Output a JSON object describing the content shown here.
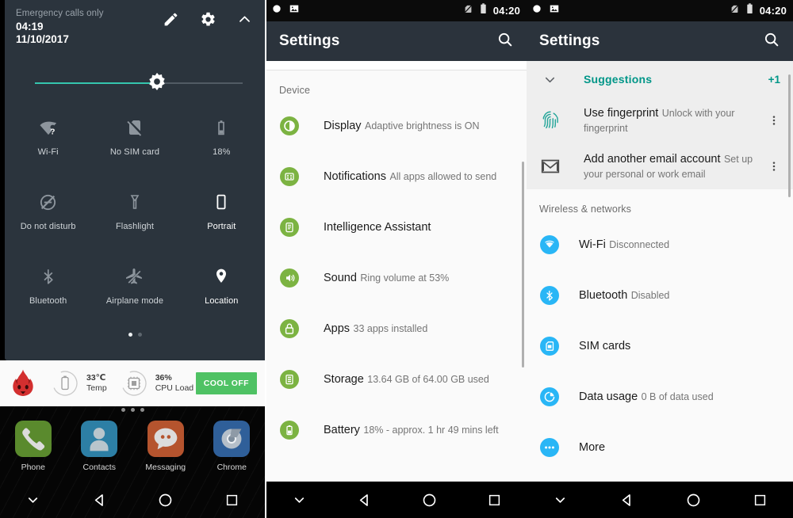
{
  "panel_quick_settings": {
    "status": {
      "carrier": "Emergency calls only",
      "time": "04:19",
      "date": "11/10/2017"
    },
    "header_icons": [
      {
        "name": "edit-pencil-icon",
        "label": "Edit"
      },
      {
        "name": "gear-icon",
        "label": "Settings"
      },
      {
        "name": "chevron-up-icon",
        "label": "Collapse"
      }
    ],
    "brightness": {
      "name": "brightness-slider",
      "value_percent": 55
    },
    "tiles": [
      {
        "label": "Wi-Fi",
        "icon": "wifi-question-icon",
        "state": "off"
      },
      {
        "label": "No SIM card",
        "icon": "no-sim-card-icon",
        "state": "off"
      },
      {
        "label": "18%",
        "icon": "battery-icon",
        "state": "off"
      },
      {
        "label": "Do not disturb",
        "icon": "do-not-disturb-icon",
        "state": "off"
      },
      {
        "label": "Flashlight",
        "icon": "flashlight-icon",
        "state": "off"
      },
      {
        "label": "Portrait",
        "icon": "screen-rotation-portrait-icon",
        "state": "on"
      },
      {
        "label": "Bluetooth",
        "icon": "bluetooth-icon",
        "state": "off"
      },
      {
        "label": "Airplane mode",
        "icon": "airplane-mode-icon",
        "state": "off"
      },
      {
        "label": "Location",
        "icon": "location-pin-icon",
        "state": "on"
      }
    ],
    "page_dots": {
      "count": 2,
      "active_index": 0
    },
    "notification_widget": {
      "app_icon": "antutu-flame-icon",
      "stats": [
        {
          "value": "33℃",
          "label": "Temp",
          "icon": "battery-outline-icon"
        },
        {
          "value": "36%",
          "label": "CPU Load",
          "icon": "cpu-chip-icon"
        }
      ],
      "action_label": "COOL OFF",
      "action_color": "#4fc264"
    },
    "home_screen": {
      "page_dots": {
        "count": 3,
        "active_index": 1
      },
      "dock": [
        {
          "label": "Phone",
          "icon": "phone-handset-icon",
          "color": "#5a8a2d"
        },
        {
          "label": "Contacts",
          "icon": "contacts-person-icon",
          "color": "#2d7fa5"
        },
        {
          "label": "Messaging",
          "icon": "messaging-bubble-icon",
          "color": "#b5542e"
        },
        {
          "label": "Chrome",
          "icon": "chrome-browser-icon",
          "color": "#2f5f99"
        }
      ]
    },
    "navbar": [
      {
        "name": "nav-hide-icon",
        "label": "Hide keyboard"
      },
      {
        "name": "nav-back-icon",
        "label": "Back"
      },
      {
        "name": "nav-home-icon",
        "label": "Home"
      },
      {
        "name": "nav-recents-icon",
        "label": "Recents"
      }
    ]
  },
  "panel_settings": {
    "statusbar": {
      "icons_left": [
        "record-circle-icon",
        "screenshot-image-icon"
      ],
      "icons_right": [
        "no-sim-icon",
        "battery-icon"
      ],
      "clock": "04:20"
    },
    "appbar": {
      "title": "Settings",
      "search_icon": "search-icon"
    },
    "section_label": "Device",
    "items": [
      {
        "title": "Display",
        "subtitle": "Adaptive brightness is ON",
        "icon": "display-brightness-icon",
        "color": "#7cb342"
      },
      {
        "title": "Notifications",
        "subtitle": "All apps allowed to send",
        "icon": "notifications-icon",
        "color": "#7cb342"
      },
      {
        "title": "Intelligence Assistant",
        "subtitle": "",
        "icon": "intelligence-assistant-icon",
        "color": "#7cb342"
      },
      {
        "title": "Sound",
        "subtitle": "Ring volume at 53%",
        "icon": "sound-volume-icon",
        "color": "#7cb342"
      },
      {
        "title": "Apps",
        "subtitle": "33 apps installed",
        "icon": "apps-icon",
        "color": "#7cb342"
      },
      {
        "title": "Storage",
        "subtitle": "13.64 GB of 64.00 GB used",
        "icon": "storage-icon",
        "color": "#7cb342"
      },
      {
        "title": "Battery",
        "subtitle": "18% - approx. 1 hr 49 mins left",
        "icon": "battery-settings-icon",
        "color": "#7cb342"
      }
    ],
    "navbar": [
      {
        "name": "nav-hide-icon",
        "label": "Hide keyboard"
      },
      {
        "name": "nav-back-icon",
        "label": "Back"
      },
      {
        "name": "nav-home-icon",
        "label": "Home"
      },
      {
        "name": "nav-recents-icon",
        "label": "Recents"
      }
    ]
  },
  "panel_suggestions": {
    "statusbar": {
      "icons_left": [
        "record-circle-icon",
        "screenshot-image-icon"
      ],
      "icons_right": [
        "no-sim-icon",
        "battery-icon"
      ],
      "clock": "04:20"
    },
    "appbar": {
      "title": "Settings",
      "search_icon": "search-icon"
    },
    "suggestions": {
      "title": "Suggestions",
      "count_badge": "+1",
      "accent_color": "#009688",
      "items": [
        {
          "title": "Use fingerprint",
          "subtitle": "Unlock with your fingerprint",
          "icon": "fingerprint-icon"
        },
        {
          "title": "Add another email account",
          "subtitle": "Set up your personal or work email",
          "icon": "gmail-envelope-icon"
        }
      ]
    },
    "section_label": "Wireless & networks",
    "items": [
      {
        "title": "Wi-Fi",
        "subtitle": "Disconnected",
        "icon": "wifi-icon",
        "color": "#29b6f6"
      },
      {
        "title": "Bluetooth",
        "subtitle": "Disabled",
        "icon": "bluetooth-icon",
        "color": "#29b6f6"
      },
      {
        "title": "SIM cards",
        "subtitle": "",
        "icon": "sim-card-icon",
        "color": "#29b6f6"
      },
      {
        "title": "Data usage",
        "subtitle": "0 B of data used",
        "icon": "data-usage-icon",
        "color": "#29b6f6"
      },
      {
        "title": "More",
        "subtitle": "",
        "icon": "more-horizontal-icon",
        "color": "#29b6f6"
      }
    ],
    "navbar": [
      {
        "name": "nav-hide-icon",
        "label": "Hide keyboard"
      },
      {
        "name": "nav-back-icon",
        "label": "Back"
      },
      {
        "name": "nav-home-icon",
        "label": "Home"
      },
      {
        "name": "nav-recents-icon",
        "label": "Recents"
      }
    ]
  }
}
